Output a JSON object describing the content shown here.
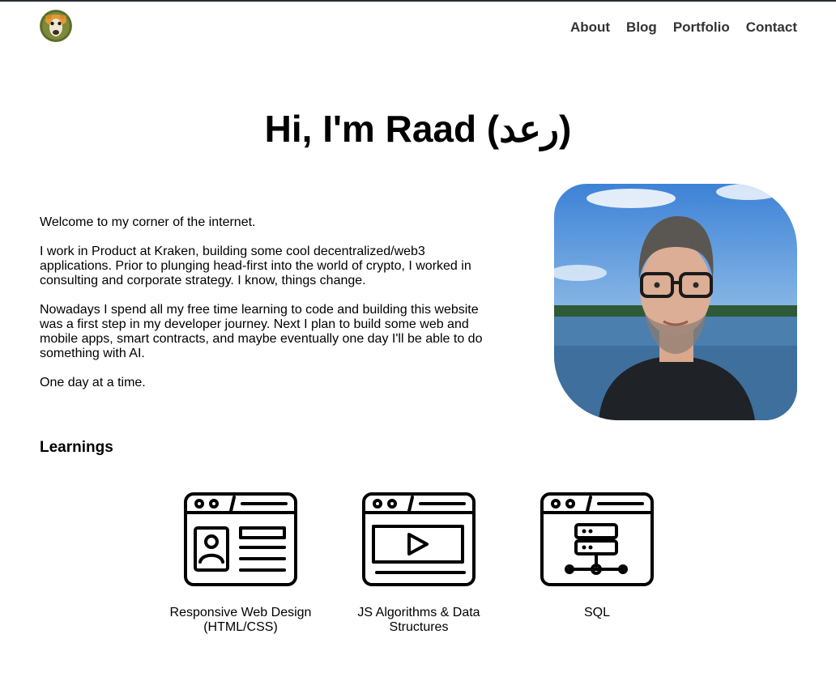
{
  "header": {
    "logo_icon": "llama-avatar-icon",
    "nav": [
      "About",
      "Blog",
      "Portfolio",
      "Contact"
    ]
  },
  "hero": {
    "title": "Hi, I'm Raad (رعد)"
  },
  "intro": {
    "paragraphs": [
      "Welcome to my corner of the internet.",
      "I work in Product at Kraken, building some cool decentralized/web3 applications. Prior to plunging head-first into the world of crypto, I worked in consulting and corporate strategy. I know, things change.",
      "Nowadays I spend all my free time learning to code and building this website was a first step in my developer journey. Next I plan to build some web and mobile apps, smart contracts, and maybe eventually one day I'll be able to do something with AI.",
      "One day at a time."
    ]
  },
  "learnings": {
    "title": "Learnings",
    "items": [
      {
        "label": "Responsive Web Design (HTML/CSS)",
        "icon": "browser-profile-icon"
      },
      {
        "label": "JS Algorithms & Data Structures",
        "icon": "browser-video-icon"
      },
      {
        "label": "SQL",
        "icon": "browser-database-icon"
      }
    ]
  }
}
